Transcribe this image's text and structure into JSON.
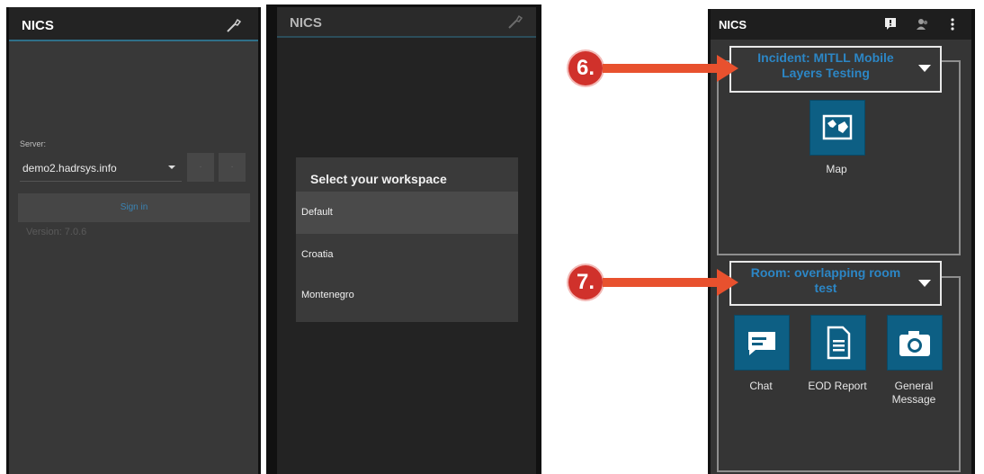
{
  "panel1": {
    "app_title": "NICS",
    "toolbar_icon": "wrench-icon",
    "server_label": "Server:",
    "server_value": "demo2.hadrsys.info",
    "sign_in_label": "Sign in",
    "version_text": "Version: 7.0.6"
  },
  "panel2": {
    "app_title": "NICS",
    "toolbar_icon": "wrench-icon",
    "dialog_title": "Select your workspace",
    "workspaces": [
      "Default",
      "Croatia",
      "Montenegro"
    ],
    "selected_workspace": "Default"
  },
  "panel3": {
    "app_title": "NICS",
    "toolbar_icons": [
      "alert-icon",
      "user-icon",
      "more-vert-icon"
    ],
    "incident_title": "Incident: MITLL Mobile Layers Testing",
    "incident_tiles": [
      {
        "label": "Map",
        "icon": "map-icon"
      }
    ],
    "room_title": "Room: overlapping room test",
    "room_tiles": [
      {
        "label": "Chat",
        "icon": "chat-icon"
      },
      {
        "label": "EOD Report",
        "icon": "document-icon"
      },
      {
        "label": "General Message",
        "icon": "camera-icon"
      }
    ]
  },
  "callouts": [
    "6.",
    "7."
  ],
  "colors": {
    "accent_blue": "#2c86c5",
    "tile_blue": "#0d5f84",
    "callout_red": "#d0312b",
    "arrow_orange": "#e8512e"
  }
}
